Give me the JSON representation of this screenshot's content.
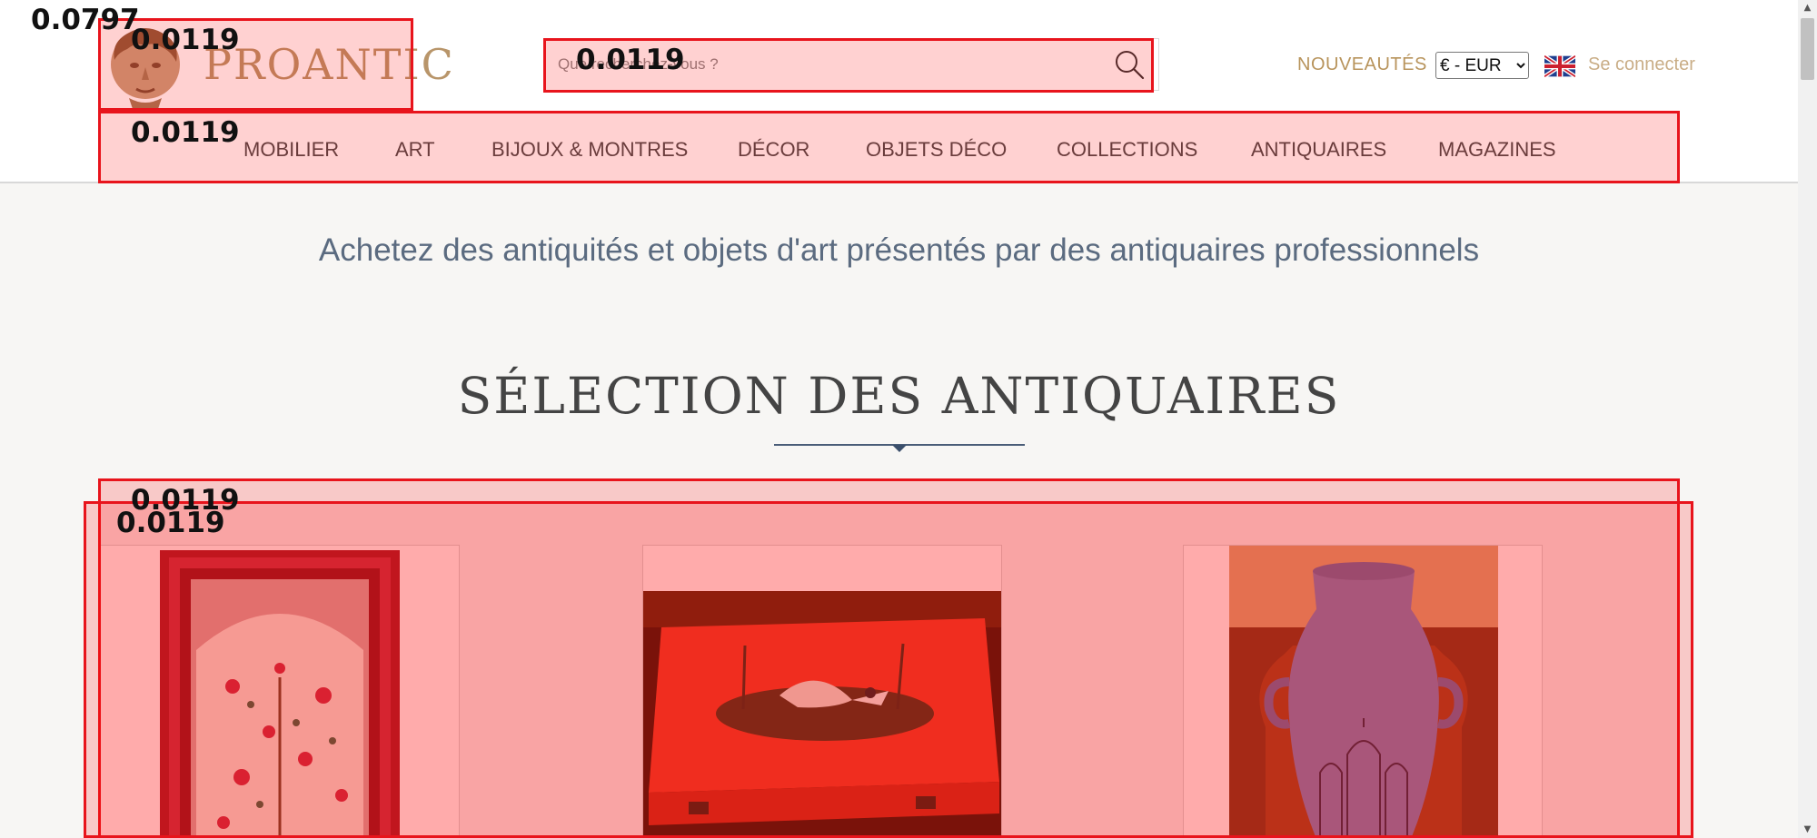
{
  "header": {
    "logo_text": "PROANTIC",
    "search": {
      "placeholder": "Que recherchez-vous ?"
    },
    "nouveautes_label": "NOUVEAUTÉS",
    "currency": {
      "selected": "€ - EUR"
    },
    "language_icon": "uk-flag-icon",
    "login_label": "Se connecter"
  },
  "nav": {
    "items": [
      {
        "label": "MOBILIER"
      },
      {
        "label": "ART"
      },
      {
        "label": "BIJOUX & MONTRES"
      },
      {
        "label": "DÉCOR"
      },
      {
        "label": "OBJETS DÉCO"
      },
      {
        "label": "COLLECTIONS"
      },
      {
        "label": "ANTIQUAIRES"
      },
      {
        "label": "MAGAZINES"
      }
    ]
  },
  "main": {
    "tagline": "Achetez des antiquités et objets d'art présentés par des antiquaires professionnels",
    "section_title": "SÉLECTION DES ANTIQUAIRES",
    "cards": [
      {
        "image": "persian-rug-image"
      },
      {
        "image": "red-lacquered-box-image"
      },
      {
        "image": "blue-ceramic-vase-image"
      }
    ]
  },
  "overlay": {
    "scores": [
      "0.0797",
      "0.0119",
      "0.0119",
      "0.0119",
      "0.0119",
      "0.0119"
    ],
    "color": "#e8141c"
  },
  "colors": {
    "brand_gold": "#b8956a",
    "nav_text": "#4a4a4a",
    "tagline_blue": "#5b6b80",
    "page_background": "#f7f6f4"
  }
}
